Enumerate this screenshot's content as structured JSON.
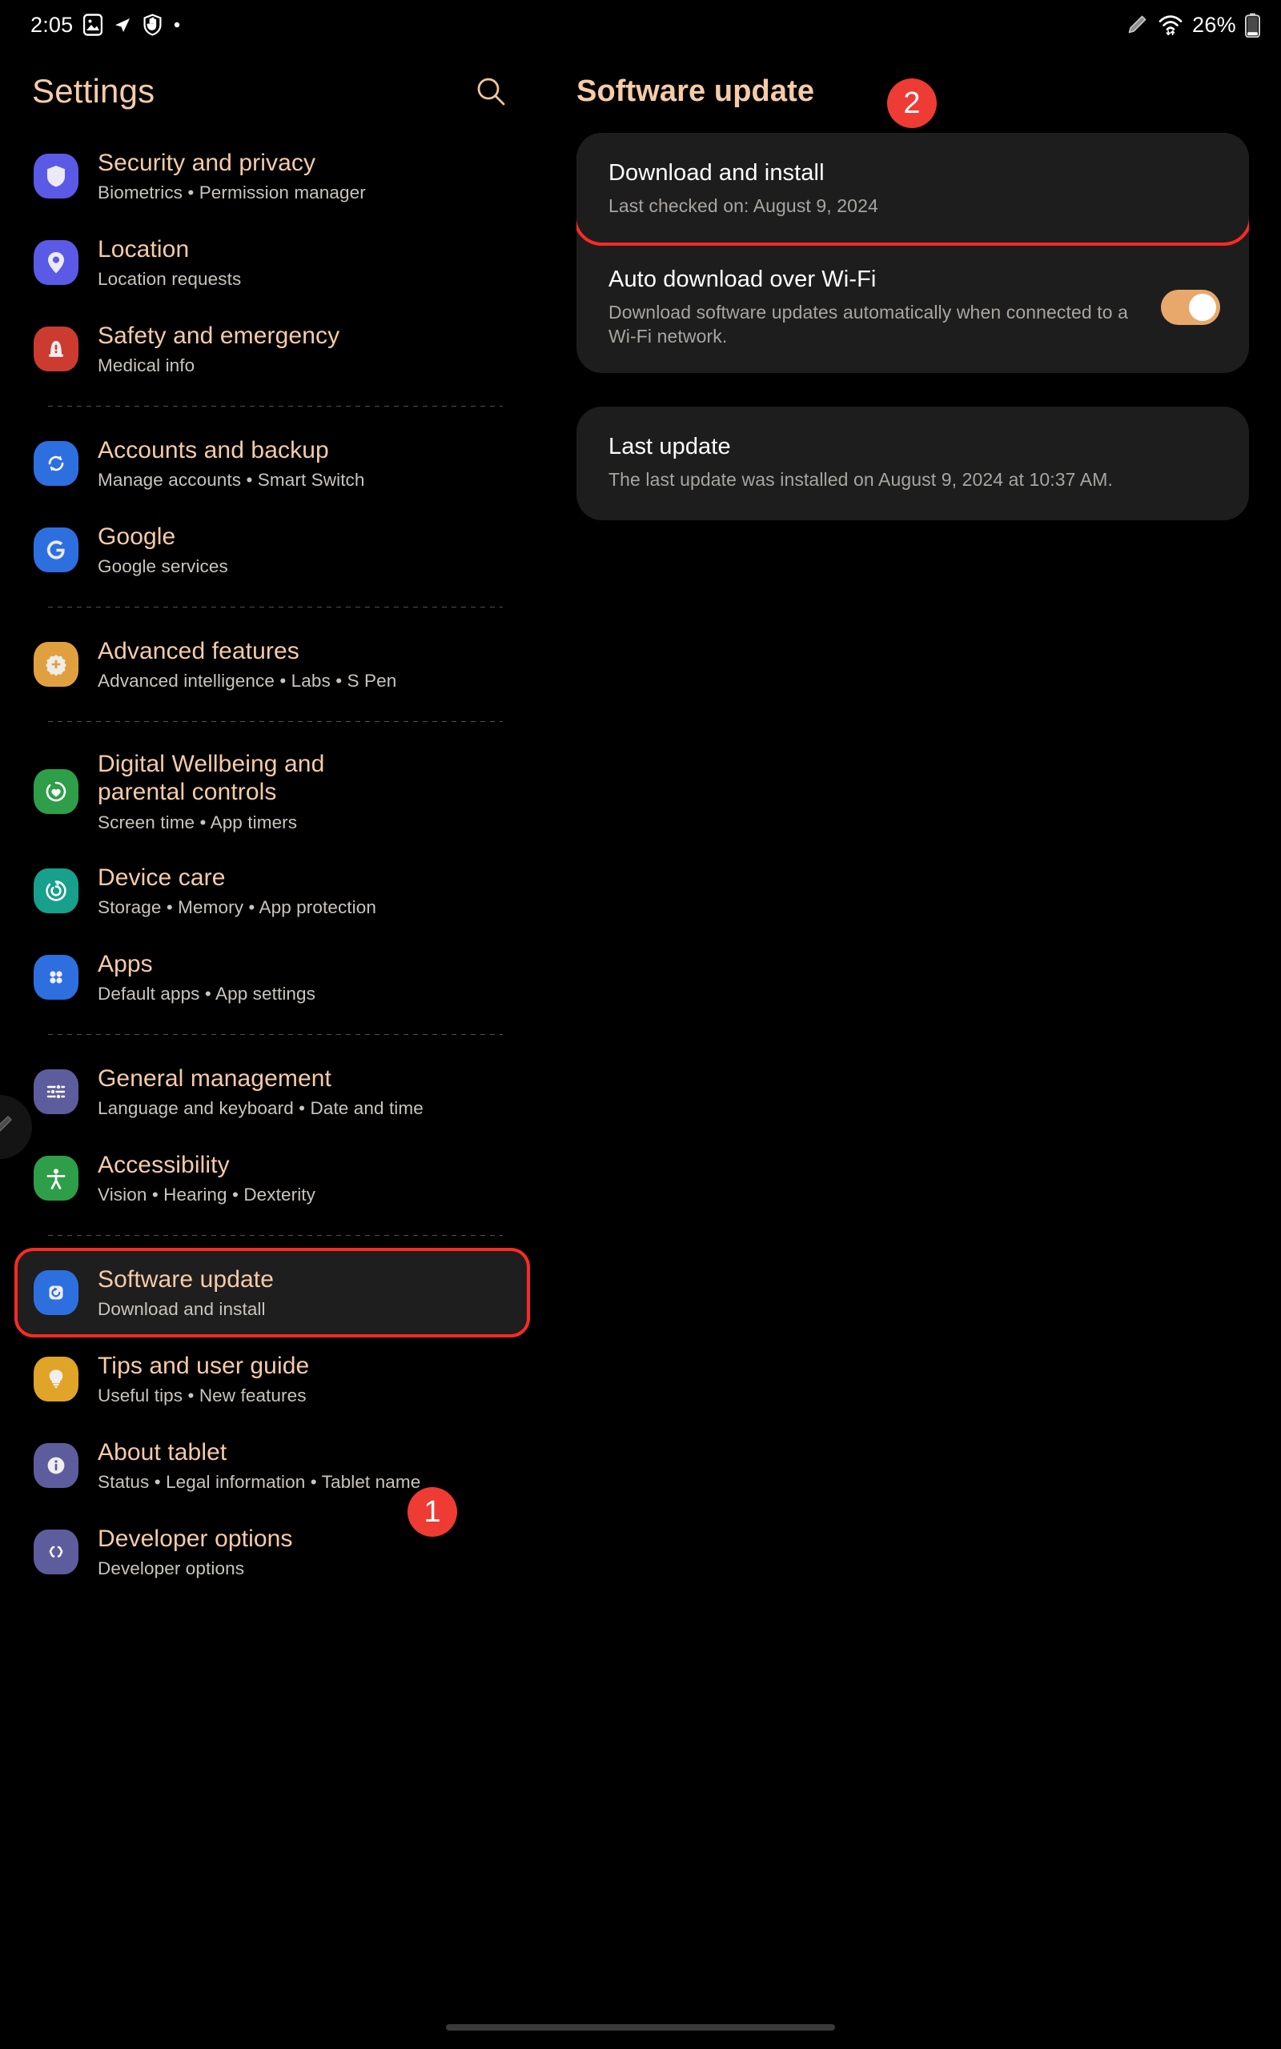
{
  "status_bar": {
    "time": "2:05",
    "battery_percent": "26%",
    "left_icons": [
      "image-icon",
      "navigation-icon",
      "shield-hand-icon",
      "dot-icon"
    ],
    "right_icons": [
      "stylus-icon",
      "wifi-icon",
      "battery-icon"
    ]
  },
  "sidebar": {
    "title": "Settings",
    "search_icon": "search-icon",
    "items": [
      {
        "id": "security-and-privacy",
        "title": "Security and privacy",
        "subtitle": "Biometrics  •  Permission manager",
        "icon": "shield-icon",
        "icon_color": "#5A5AE6",
        "divider_after": false
      },
      {
        "id": "location",
        "title": "Location",
        "subtitle": "Location requests",
        "icon": "location-pin-icon",
        "icon_color": "#5A5AE6",
        "divider_after": false
      },
      {
        "id": "safety-and-emergency",
        "title": "Safety and emergency",
        "subtitle": "Medical info",
        "icon": "emergency-siren-icon",
        "icon_color": "#CC3B30",
        "divider_after": true
      },
      {
        "id": "accounts-and-backup",
        "title": "Accounts and backup",
        "subtitle": "Manage accounts  •  Smart Switch",
        "icon": "sync-icon",
        "icon_color": "#2E6FE0",
        "divider_after": false
      },
      {
        "id": "google",
        "title": "Google",
        "subtitle": "Google services",
        "icon": "google-g-icon",
        "icon_color": "#2E6FE0",
        "divider_after": true
      },
      {
        "id": "advanced-features",
        "title": "Advanced features",
        "subtitle": "Advanced intelligence  •  Labs  •  S Pen",
        "icon": "gear-plus-icon",
        "icon_color": "#E0A03F",
        "divider_after": true
      },
      {
        "id": "digital-wellbeing",
        "title": "Digital Wellbeing and parental controls",
        "subtitle": "Screen time  •  App timers",
        "icon": "wellbeing-heart-icon",
        "icon_color": "#2E9E48",
        "divider_after": false
      },
      {
        "id": "device-care",
        "title": "Device care",
        "subtitle": "Storage  •  Memory  •  App protection",
        "icon": "device-care-icon",
        "icon_color": "#17A08C",
        "divider_after": false
      },
      {
        "id": "apps",
        "title": "Apps",
        "subtitle": "Default apps  •  App settings",
        "icon": "apps-grid-icon",
        "icon_color": "#2E6FE0",
        "divider_after": true
      },
      {
        "id": "general-management",
        "title": "General management",
        "subtitle": "Language and keyboard  •  Date and time",
        "icon": "sliders-icon",
        "icon_color": "#5D5D9E",
        "divider_after": false
      },
      {
        "id": "accessibility",
        "title": "Accessibility",
        "subtitle": "Vision  •  Hearing  •  Dexterity",
        "icon": "accessibility-person-icon",
        "icon_color": "#2E9E48",
        "divider_after": true
      },
      {
        "id": "software-update",
        "title": "Software update",
        "subtitle": "Download and install",
        "icon": "software-update-icon",
        "icon_color": "#2E6FE0",
        "divider_after": false,
        "highlighted": true
      },
      {
        "id": "tips-and-user-guide",
        "title": "Tips and user guide",
        "subtitle": "Useful tips  •  New features",
        "icon": "lightbulb-icon",
        "icon_color": "#E0A428",
        "divider_after": false
      },
      {
        "id": "about-tablet",
        "title": "About tablet",
        "subtitle": "Status  •  Legal information  •  Tablet name",
        "icon": "info-icon",
        "icon_color": "#5D5D9E",
        "divider_after": false
      },
      {
        "id": "developer-options",
        "title": "Developer options",
        "subtitle": "Developer options",
        "icon": "code-braces-icon",
        "icon_color": "#5D5D9E",
        "divider_after": false
      }
    ]
  },
  "detail": {
    "title": "Software update",
    "download_and_install": {
      "title": "Download and install",
      "subtitle": "Last checked on: August 9, 2024",
      "highlighted": true
    },
    "auto_download": {
      "title": "Auto download over Wi-Fi",
      "subtitle": "Download software updates automatically when connected to a Wi-Fi network.",
      "toggle_on": true
    },
    "last_update": {
      "title": "Last update",
      "subtitle": "The last update was installed on August 9, 2024 at 10:37 AM."
    }
  },
  "annotations": {
    "badge_1": "1",
    "badge_2": "2",
    "highlight_color": "#FF2A24",
    "badge_color": "#EE3B33"
  }
}
